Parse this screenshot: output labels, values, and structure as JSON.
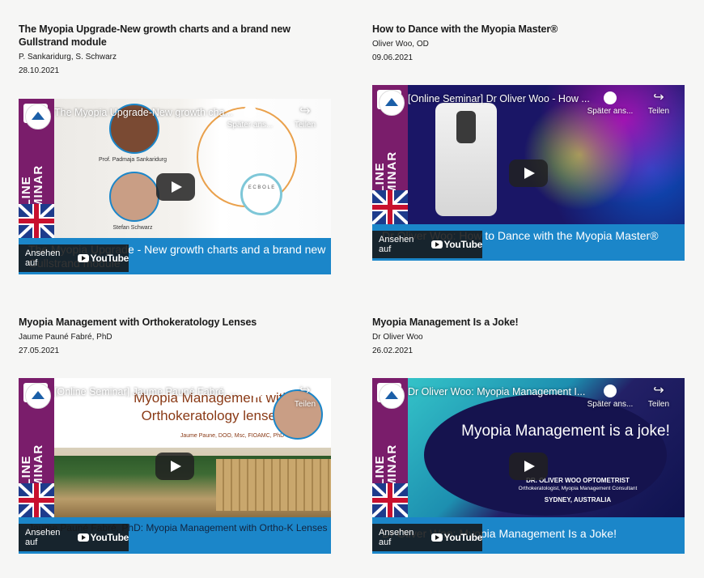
{
  "cards": [
    {
      "title": "The Myopia Upgrade-New growth charts and a brand new Gullstrand module",
      "authors": "P. Sankaridurg, S. Schwarz",
      "date": "28.10.2021",
      "video": {
        "yt_title": "The Myopia Upgrade-New growth cha...",
        "banner_text": "ONLINE SEMINAR",
        "watch_later": "Später ans...",
        "share": "Teilen",
        "watch_on": "Ansehen auf",
        "yt_brand": "YouTube",
        "bottom_text": "The Myopia Upgrade - New growth charts and a brand new Gullstrand module",
        "caption_1": "Prof. Padmaja Sankaridurg",
        "caption_2": "Stefan Schwarz",
        "chart_text": "E C B O L E"
      }
    },
    {
      "title": "How to Dance with the Myopia Master®",
      "authors": "Oliver Woo, OD",
      "date": "09.06.2021",
      "video": {
        "yt_title": "[Online Seminar] Dr Oliver Woo - How ...",
        "banner_text": "ONLINE SEMINAR",
        "watch_later": "Später ans...",
        "share": "Teilen",
        "watch_on": "Ansehen auf",
        "yt_brand": "YouTube",
        "bottom_text": "Dr Oliver Woo: How to Dance with the Myopia Master®"
      }
    },
    {
      "title": "Myopia Management with Orthokeratology Lenses",
      "authors": "Jaume Pauné Fabré, PhD",
      "date": "27.05.2021",
      "video": {
        "yt_title": "[Online Seminar] Jaume Pauné Fabré, ...",
        "banner_text": "ONLINE SEMINAR",
        "watch_later": "Später ans...",
        "share": "Teilen",
        "watch_on": "Ansehen auf",
        "yt_brand": "YouTube",
        "bottom_text": "Jaume Pauné Fabré, PhD: Myopia Management with Ortho-K Lenses",
        "thumb_title": "Myopia Management with Orthokeratology lenses",
        "thumb_sub": "Jaume Paune, DOO, Msc, FIOAMC, PhD"
      }
    },
    {
      "title": "Myopia Management Is a Joke!",
      "authors": "Dr Oliver Woo",
      "date": "26.02.2021",
      "video": {
        "yt_title": "Dr Oliver Woo: Myopia Management I...",
        "banner_text": "ONLINE SEMINAR",
        "watch_later": "Später ans...",
        "share": "Teilen",
        "watch_on": "Ansehen auf",
        "yt_brand": "YouTube",
        "bottom_text": "Dr Oliver Woo: Myopia Management Is a Joke!",
        "thumb_title": "Myopia Management is a joke!",
        "thumb_name": "DR. OLIVER WOO OPTOMETRIST",
        "thumb_role": "Orthokeratologist, Myopia Management Consultant",
        "thumb_location": "SYDNEY, AUSTRALIA"
      }
    }
  ],
  "colors": {
    "accent_blue": "#1b86c9",
    "banner_purple": "#7a1d6b",
    "background": "#f6f6f5"
  }
}
